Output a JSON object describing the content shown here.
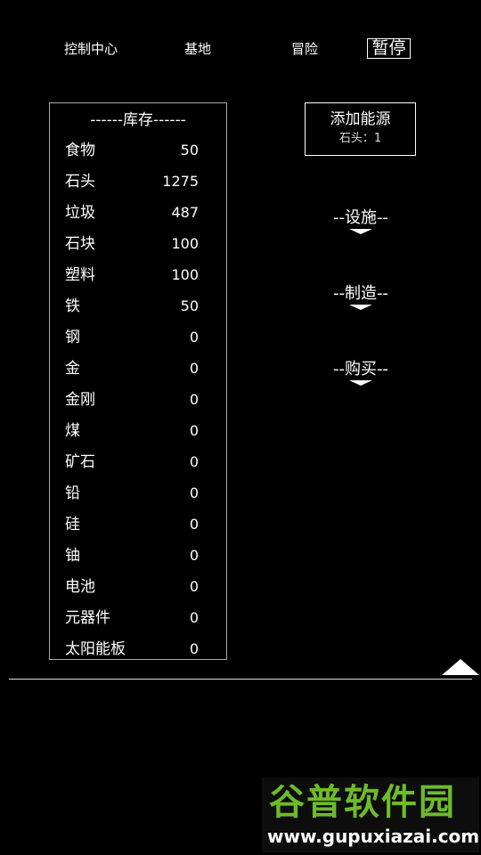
{
  "nav": {
    "tabs": [
      {
        "label": "控制中心"
      },
      {
        "label": "基地"
      },
      {
        "label": "冒险"
      }
    ],
    "pause_label": "暂停"
  },
  "inventory": {
    "header": "------库存------",
    "items": [
      {
        "name": "食物",
        "qty": "50"
      },
      {
        "name": "石头",
        "qty": "1275"
      },
      {
        "name": "垃圾",
        "qty": "487"
      },
      {
        "name": "石块",
        "qty": "100"
      },
      {
        "name": "塑料",
        "qty": "100"
      },
      {
        "name": "铁",
        "qty": "50"
      },
      {
        "name": "钢",
        "qty": "0"
      },
      {
        "name": "金",
        "qty": "0"
      },
      {
        "name": "金刚",
        "qty": "0"
      },
      {
        "name": "煤",
        "qty": "0"
      },
      {
        "name": "矿石",
        "qty": "0"
      },
      {
        "name": "铅",
        "qty": "0"
      },
      {
        "name": "硅",
        "qty": "0"
      },
      {
        "name": "铀",
        "qty": "0"
      },
      {
        "name": "电池",
        "qty": "0"
      },
      {
        "name": "元器件",
        "qty": "0"
      },
      {
        "name": "太阳能板",
        "qty": "0"
      }
    ]
  },
  "actions": {
    "add_energy": {
      "label": "添加能源",
      "cost": "石头：1"
    }
  },
  "sections": {
    "facility": "--设施--",
    "craft": "--制造--",
    "buy": "--购买--"
  },
  "watermark": {
    "brand": "谷普软件园",
    "url": "www.gupuxiazai.com"
  },
  "colors": {
    "background": "#000000",
    "text": "#ffffff",
    "panel_border": "#a8a8a8",
    "watermark_green": "#6dbb2b"
  },
  "icons": {
    "section_toggle": "chevron-down-icon",
    "panel_expand": "triangle-up-icon"
  }
}
